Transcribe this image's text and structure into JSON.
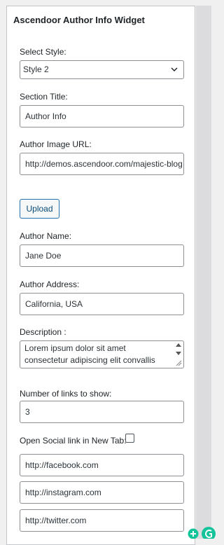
{
  "widget": {
    "title": "Ascendoor Author Info Widget"
  },
  "fields": {
    "style_label": "Select Style:",
    "style_value": "Style 2",
    "section_title_label": "Section Title:",
    "section_title_value": "Author Info",
    "image_url_label": "Author Image URL:",
    "image_url_value": "http://demos.ascendoor.com/majestic-blog",
    "upload_label": "Upload",
    "author_name_label": "Author Name:",
    "author_name_value": "Jane Doe",
    "author_address_label": "Author Address:",
    "author_address_value": "California, USA",
    "description_label": "Description :",
    "description_value": "Lorem ipsum dolor sit amet consectetur adipiscing elit convallis",
    "links_count_label": "Number of links to show:",
    "links_count_value": "3",
    "new_tab_label": "Open Social link in New Tab:",
    "new_tab_checked": false,
    "social_links": [
      "http://facebook.com",
      "http://instagram.com",
      "http://twitter.com"
    ]
  },
  "icons": {
    "select_arrow": "chevron-down-icon",
    "floating_add": "plus-circle-icon",
    "floating_grammar": "grammarly-icon"
  },
  "colors": {
    "button_border": "#2271b1",
    "floating_green": "#15c39a"
  }
}
